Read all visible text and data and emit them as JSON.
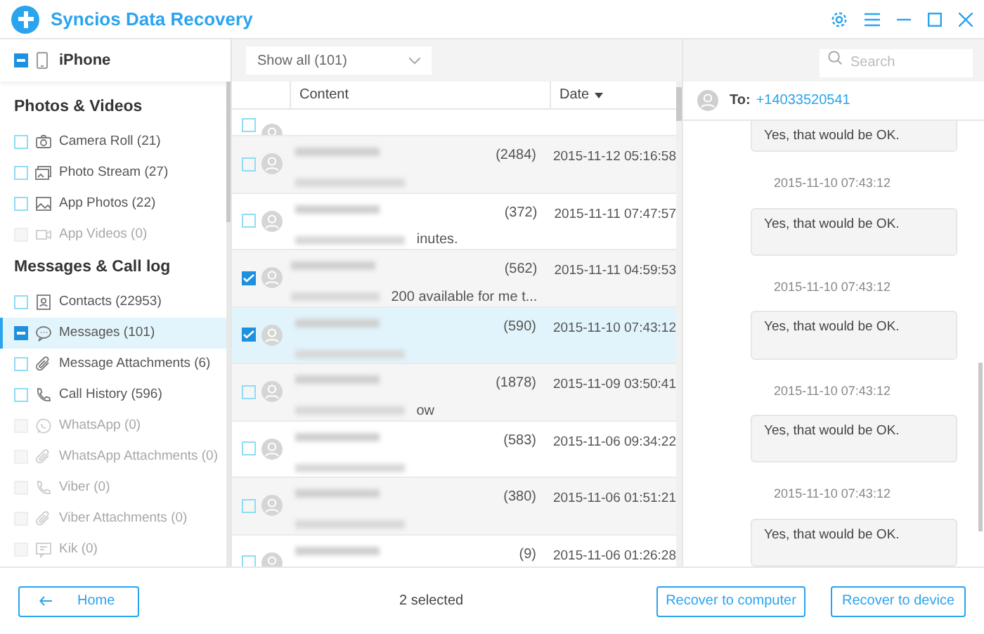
{
  "window": {
    "title": "Syncios Data Recovery"
  },
  "device": {
    "name": "iPhone",
    "checked": true,
    "indeterminate": true
  },
  "sidebar": [
    {
      "kind": "section",
      "label": "Photos & Videos"
    },
    {
      "kind": "item",
      "label": "Camera Roll (21)",
      "checked": false,
      "indeterminate": false,
      "disabled": false,
      "selected": false
    },
    {
      "kind": "item",
      "label": "Photo Stream (27)",
      "checked": false,
      "indeterminate": false,
      "disabled": false,
      "selected": false
    },
    {
      "kind": "item",
      "label": "App Photos (22)",
      "checked": false,
      "indeterminate": false,
      "disabled": false,
      "selected": false
    },
    {
      "kind": "item",
      "label": "App Videos (0)",
      "checked": false,
      "indeterminate": false,
      "disabled": true,
      "selected": false
    },
    {
      "kind": "section",
      "label": "Messages & Call log"
    },
    {
      "kind": "item",
      "label": "Contacts (22953)",
      "checked": false,
      "indeterminate": false,
      "disabled": false,
      "selected": false
    },
    {
      "kind": "item",
      "label": "Messages (101)",
      "checked": true,
      "indeterminate": true,
      "disabled": false,
      "selected": true
    },
    {
      "kind": "item",
      "label": "Message Attachments (6)",
      "checked": false,
      "indeterminate": false,
      "disabled": false,
      "selected": false
    },
    {
      "kind": "item",
      "label": "Call History (596)",
      "checked": false,
      "indeterminate": false,
      "disabled": false,
      "selected": false
    },
    {
      "kind": "item",
      "label": "WhatsApp (0)",
      "checked": false,
      "indeterminate": false,
      "disabled": true,
      "selected": false
    },
    {
      "kind": "item",
      "label": "WhatsApp Attachments (0)",
      "checked": false,
      "indeterminate": false,
      "disabled": true,
      "selected": false
    },
    {
      "kind": "item",
      "label": "Viber (0)",
      "checked": false,
      "indeterminate": false,
      "disabled": true,
      "selected": false
    },
    {
      "kind": "item",
      "label": "Viber Attachments (0)",
      "checked": false,
      "indeterminate": false,
      "disabled": true,
      "selected": false
    },
    {
      "kind": "item",
      "label": "Kik (0)",
      "checked": false,
      "indeterminate": false,
      "disabled": true,
      "selected": false
    }
  ],
  "filter": {
    "value": "Show all (101)"
  },
  "search": {
    "placeholder": "Search"
  },
  "table": {
    "columns": [
      "Content",
      "Date"
    ],
    "rows": [
      {
        "kind": "cut",
        "checked": false,
        "selected": false
      },
      {
        "kind": "full",
        "count": "(2484)",
        "date": "2015-11-12 05:16:58",
        "checked": false,
        "selected": false
      },
      {
        "kind": "full",
        "count": "(372)",
        "date": "2015-11-11 07:47:57",
        "preview_tail": "inutes.",
        "checked": false,
        "selected": false
      },
      {
        "kind": "full",
        "count": "(562)",
        "date": "2015-11-11 04:59:53",
        "preview_tail": "200 available for me t...",
        "checked": true,
        "selected": false
      },
      {
        "kind": "full",
        "count": "(590)",
        "date": "2015-11-10 07:43:12",
        "checked": true,
        "selected": true
      },
      {
        "kind": "full",
        "count": "(1878)",
        "date": "2015-11-09 03:50:41",
        "preview_tail": "ow",
        "checked": false,
        "selected": false
      },
      {
        "kind": "full",
        "count": "(583)",
        "date": "2015-11-06 09:34:22",
        "checked": false,
        "selected": false
      },
      {
        "kind": "full",
        "count": "(380)",
        "date": "2015-11-06 01:51:21",
        "checked": false,
        "selected": false
      },
      {
        "kind": "full",
        "count": "(9)",
        "date": "2015-11-06 01:26:28",
        "checked": false,
        "selected": false
      }
    ]
  },
  "conversation": {
    "to_label": "To:",
    "number": "+14033520541",
    "messages": [
      {
        "text": "Yes, that would be OK."
      },
      {
        "time": "2015-11-10 07:43:12",
        "text": "Yes, that would be OK."
      },
      {
        "time": "2015-11-10 07:43:12",
        "text": "Yes, that would be OK."
      },
      {
        "time": "2015-11-10 07:43:12",
        "text": "Yes, that would be OK."
      },
      {
        "time": "2015-11-10 07:43:12",
        "text": "Yes, that would be OK."
      }
    ]
  },
  "footer": {
    "home": "Home",
    "status": "2 selected",
    "buttons": [
      "Recover to computer",
      "Recover to device"
    ]
  }
}
